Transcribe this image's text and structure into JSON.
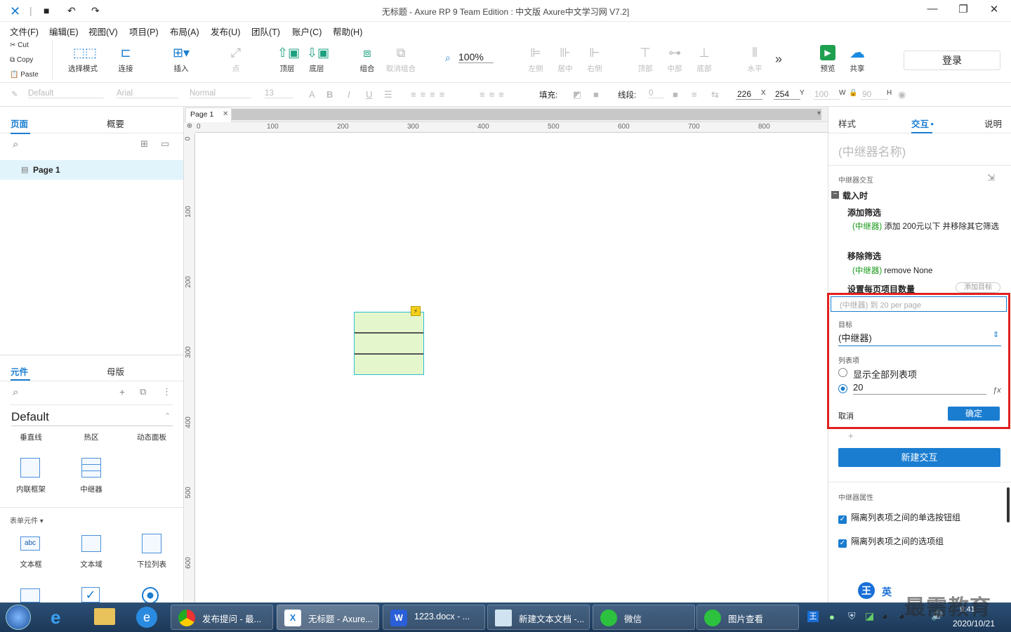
{
  "titlebar": {
    "title": "无标题 - Axure RP 9 Team Edition : 中文版    Axure中文学习网 V7.2]"
  },
  "menu": [
    "文件(F)",
    "编辑(E)",
    "视图(V)",
    "项目(P)",
    "布局(A)",
    "发布(U)",
    "团队(T)",
    "账户(C)",
    "帮助(H)"
  ],
  "clipboard": {
    "cut": "Cut",
    "copy": "Copy",
    "paste": "Paste"
  },
  "toolbar": {
    "select_mode": "选择模式",
    "connect": "连接",
    "insert": "插入",
    "point": "点",
    "top": "顶层",
    "bottom": "底层",
    "group": "组合",
    "ungroup": "取消组合",
    "zoom": "100%",
    "left": "左侧",
    "center": "居中",
    "right": "右侧",
    "align_top": "顶部",
    "align_middle": "中部",
    "align_bottom": "底部",
    "horizontal": "水平",
    "preview": "预览",
    "share": "共享",
    "login": "登录"
  },
  "format": {
    "style": "Default",
    "font": "Arial",
    "weight": "Normal",
    "size": "13",
    "fill_label": "填充:",
    "stroke_label": "线段:",
    "stroke_value": "0",
    "x": "226",
    "x_label": "X",
    "y": "254",
    "y_label": "Y",
    "w": "100",
    "w_label": "W",
    "h": "90",
    "h_label": "H"
  },
  "left": {
    "tab_pages": "页面",
    "tab_outline": "概要",
    "page1": "Page 1",
    "tab_widgets": "元件",
    "tab_masters": "母版",
    "library": "Default",
    "widgets_row1": [
      "垂直线",
      "热区",
      "动态面板"
    ],
    "widgets_row2": [
      "内联框架",
      "中继器"
    ],
    "form_section": "表单元件 ▾",
    "widgets_row3": [
      "文本框",
      "文本域",
      "下拉列表"
    ]
  },
  "canvas": {
    "page_tab": "Page 1",
    "ruler_h": [
      "0",
      "100",
      "200",
      "300",
      "400",
      "500",
      "600",
      "700",
      "800"
    ],
    "ruler_v": [
      "0",
      "100",
      "200",
      "300",
      "400",
      "500",
      "600"
    ]
  },
  "right": {
    "tab_style": "样式",
    "tab_interact": "交互",
    "tab_notes": "说明",
    "repeater_name": "(中继器名称)",
    "section_interactions": "中继器交互",
    "event_onload": "载入时",
    "action_add_filter": "添加筛选",
    "action_add_filter_target": "(中继器)",
    "action_add_filter_desc": " 添加 200元以下 并移除其它筛选",
    "action_remove_filter": "移除筛选",
    "action_remove_filter_target": "(中继器)",
    "action_remove_filter_desc": " remove None",
    "action_items_per_page": "设置每页项目数量",
    "add_target": "添加目标",
    "editor_summary": "(中继器) 到 20 per page",
    "target_label": "目标",
    "target_value": "(中继器)",
    "items_label": "列表项",
    "show_all": "显示全部列表项",
    "count_value": "20",
    "cancel": "取消",
    "ok": "确定",
    "new_interaction": "新建交互",
    "props_title": "中继器属性",
    "prop1": "隔离列表项之间的单选按钮组",
    "prop2": "隔离列表项之间的选项组"
  },
  "taskbar": {
    "tasks": [
      "发布提问 - 最...",
      "无标题 - Axure...",
      "1223.docx - ...",
      "新建文本文档 -...",
      "微信",
      "图片查看"
    ],
    "ime": "英",
    "time": "9:41",
    "date": "2020/10/21",
    "watermark": "最需教育"
  },
  "colors": {
    "accent": "#1a7dd0",
    "highlight": "#e02020",
    "repeater_fill": "#e4f7cc",
    "repeater_border": "#2bbfd0"
  }
}
